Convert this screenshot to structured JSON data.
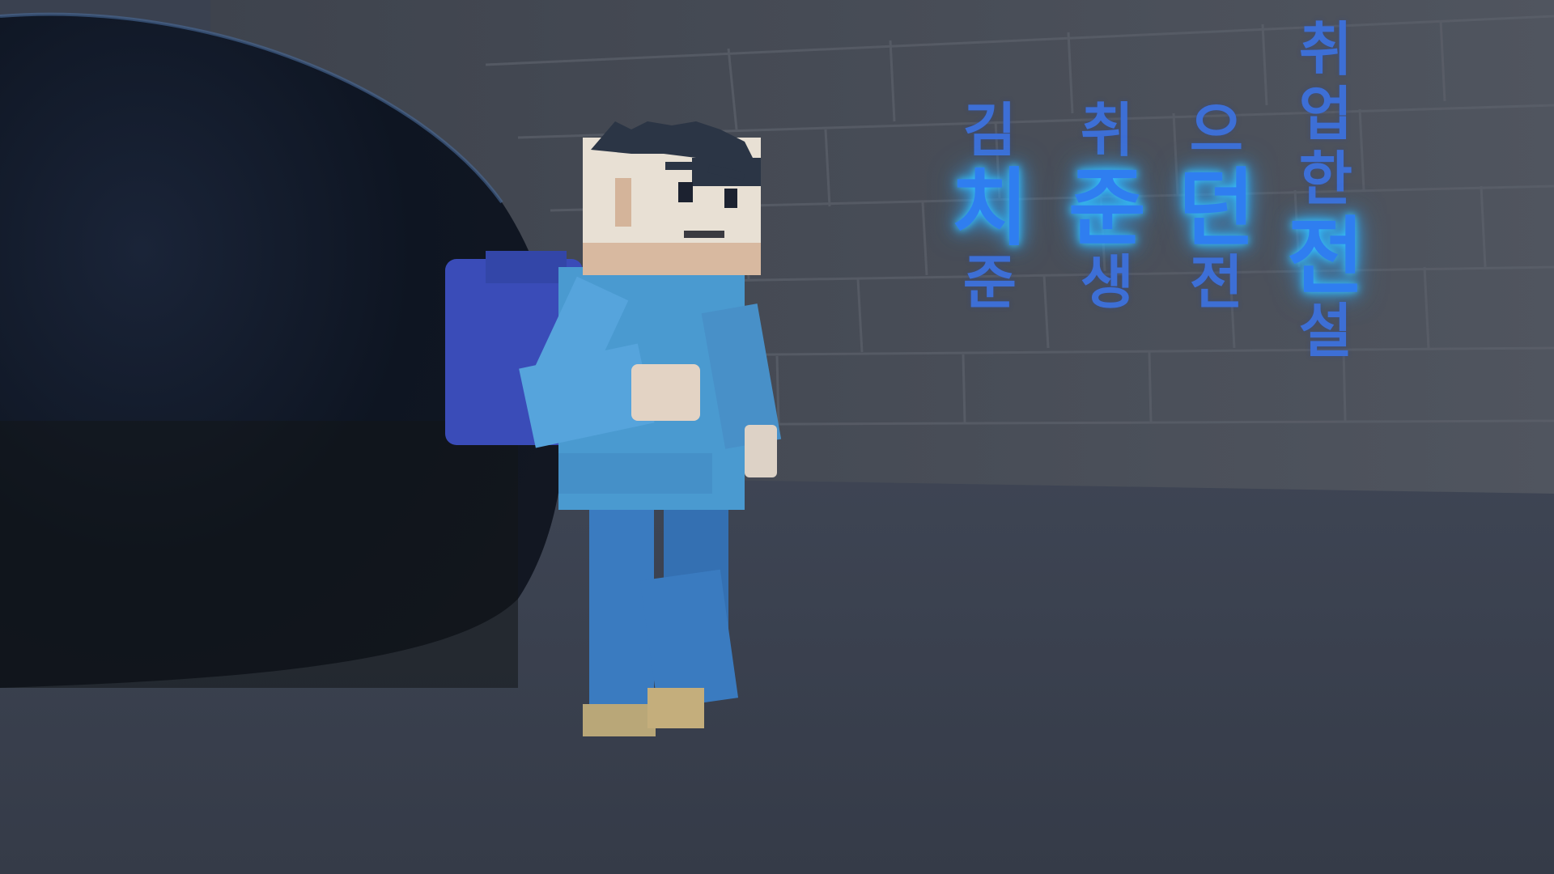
{
  "title": {
    "columns": [
      {
        "chars": [
          "김",
          "치",
          "준"
        ],
        "big": [
          false,
          true,
          false
        ]
      },
      {
        "chars": [
          "취",
          "준",
          "생"
        ],
        "big": [
          false,
          true,
          false
        ]
      },
      {
        "chars": [
          "으",
          "던",
          "전"
        ],
        "big": [
          false,
          true,
          false
        ]
      },
      {
        "chars": [
          "취",
          "업",
          "한",
          "전",
          "설"
        ],
        "big": [
          false,
          false,
          false,
          true,
          false
        ]
      }
    ]
  },
  "colors": {
    "title_text": "#3d6fd6",
    "title_glow": "#35c6ff",
    "floor": "#3a4150",
    "wall": "#4a4f5a",
    "dome": "#0d1320",
    "character_shirt": "#4a9ad0",
    "character_pants": "#3a7bc0",
    "character_backpack": "#3a4cb8",
    "character_skin": "#e8e0d4"
  }
}
